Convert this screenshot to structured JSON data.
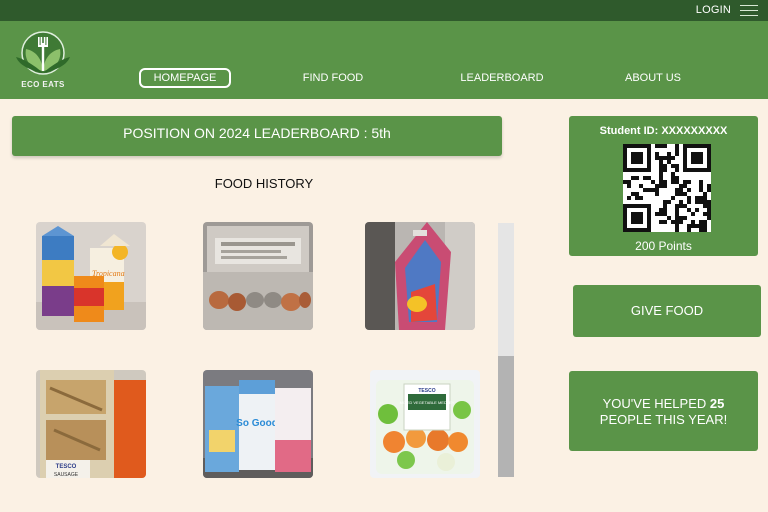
{
  "topbar": {
    "login": "LOGIN"
  },
  "brand": {
    "name": "ECO EATS"
  },
  "nav": {
    "homepage": "HOMEPAGE",
    "find_food": "FIND FOOD",
    "leaderboard": "LEADERBOARD",
    "about_us": "ABOUT US"
  },
  "position_banner": "POSITION ON 2024 LEADERBOARD : 5th",
  "food_history": {
    "title": "FOOD HISTORY",
    "items": [
      "juice-cartons",
      "egg-carton",
      "bagged-snack",
      "sandwich",
      "milk-cartons",
      "vegetable-medley"
    ],
    "packaging_text": {
      "juice_brand": "Tropicana",
      "sandwich_brand": "TESCO",
      "sandwich_label": "SAUSAGE",
      "milk_brand": "So Good",
      "veg_brand": "TESCO",
      "veg_label": "MIXED VEGETABLE MEDLEY"
    }
  },
  "scrollbar": {
    "position": 0.52
  },
  "student": {
    "id_label": "Student ID: XXXXXXXXX",
    "points": "200 Points"
  },
  "give_food": {
    "label": "GIVE FOOD"
  },
  "impact": {
    "prefix": "YOU'VE HELPED",
    "count": "25",
    "suffix": "PEOPLE THIS YEAR!"
  },
  "colors": {
    "topbar": "#2f5a2c",
    "brand_green": "#5a9448",
    "background": "#fbf1e4",
    "text_light": "#ffffff"
  }
}
